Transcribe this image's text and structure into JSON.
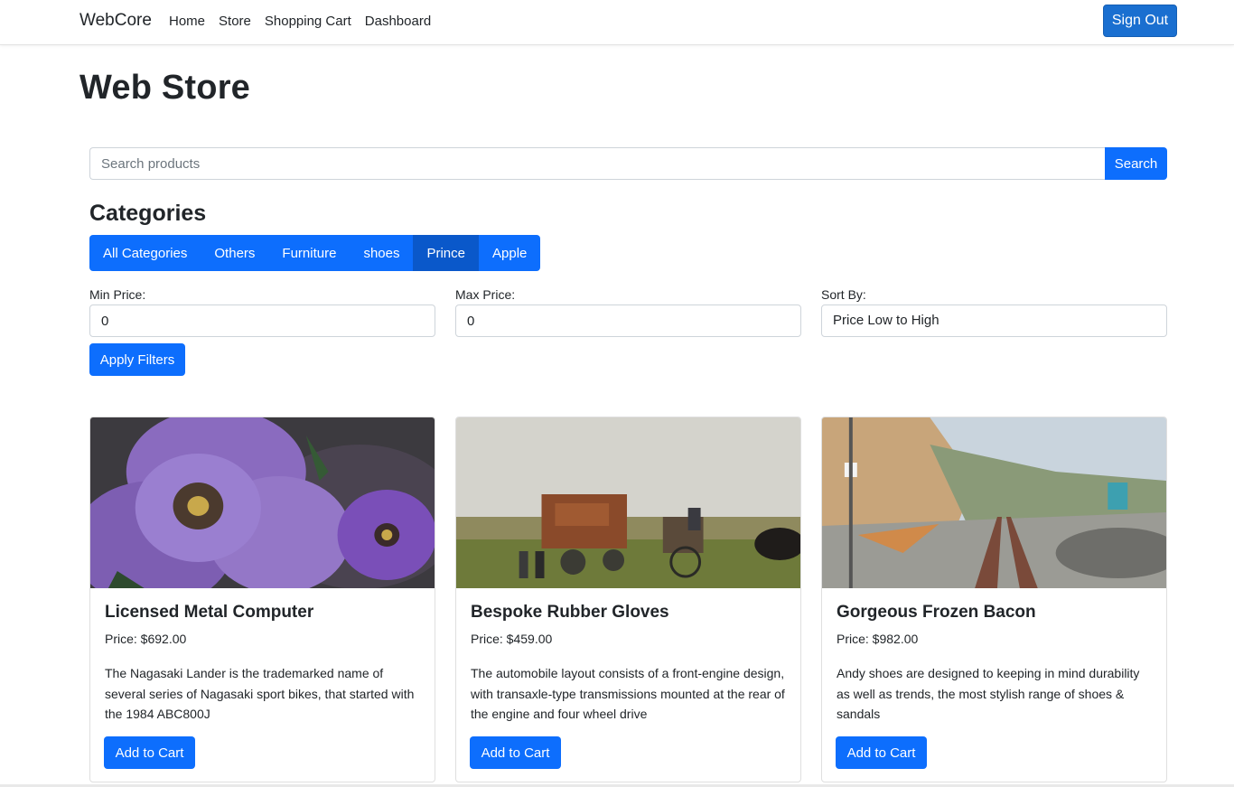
{
  "nav": {
    "brand": "WebCore",
    "links": [
      "Home",
      "Store",
      "Shopping Cart",
      "Dashboard"
    ],
    "signout": "Sign Out"
  },
  "page": {
    "title": "Web Store"
  },
  "search": {
    "placeholder": "Search products",
    "button": "Search"
  },
  "categories": {
    "title": "Categories",
    "items": [
      "All Categories",
      "Others",
      "Furniture",
      "shoes",
      "Prince",
      "Apple"
    ],
    "active": "Prince"
  },
  "filters": {
    "min_label": "Min Price:",
    "min_value": "0",
    "max_label": "Max Price:",
    "max_value": "0",
    "sort_label": "Sort By:",
    "sort_value": "Price Low to High",
    "apply": "Apply Filters"
  },
  "products": [
    {
      "name": "Licensed Metal Computer",
      "price": "Price: $692.00",
      "description": "The Nagasaki Lander is the trademarked name of several series of Nagasaki sport bikes, that started with the 1984 ABC800J",
      "button": "Add to Cart"
    },
    {
      "name": "Bespoke Rubber Gloves",
      "price": "Price: $459.00",
      "description": "The automobile layout consists of a front-engine design, with transaxle-type transmissions mounted at the rear of the engine and four wheel drive",
      "button": "Add to Cart"
    },
    {
      "name": "Gorgeous Frozen Bacon",
      "price": "Price: $982.00",
      "description": "Andy shoes are designed to keeping in mind durability as well as trends, the most stylish range of shoes & sandals",
      "button": "Add to Cart"
    }
  ],
  "colors": {
    "primary": "#0d6efd",
    "active": "#0a58ca",
    "signout": "#1a6fd0"
  }
}
